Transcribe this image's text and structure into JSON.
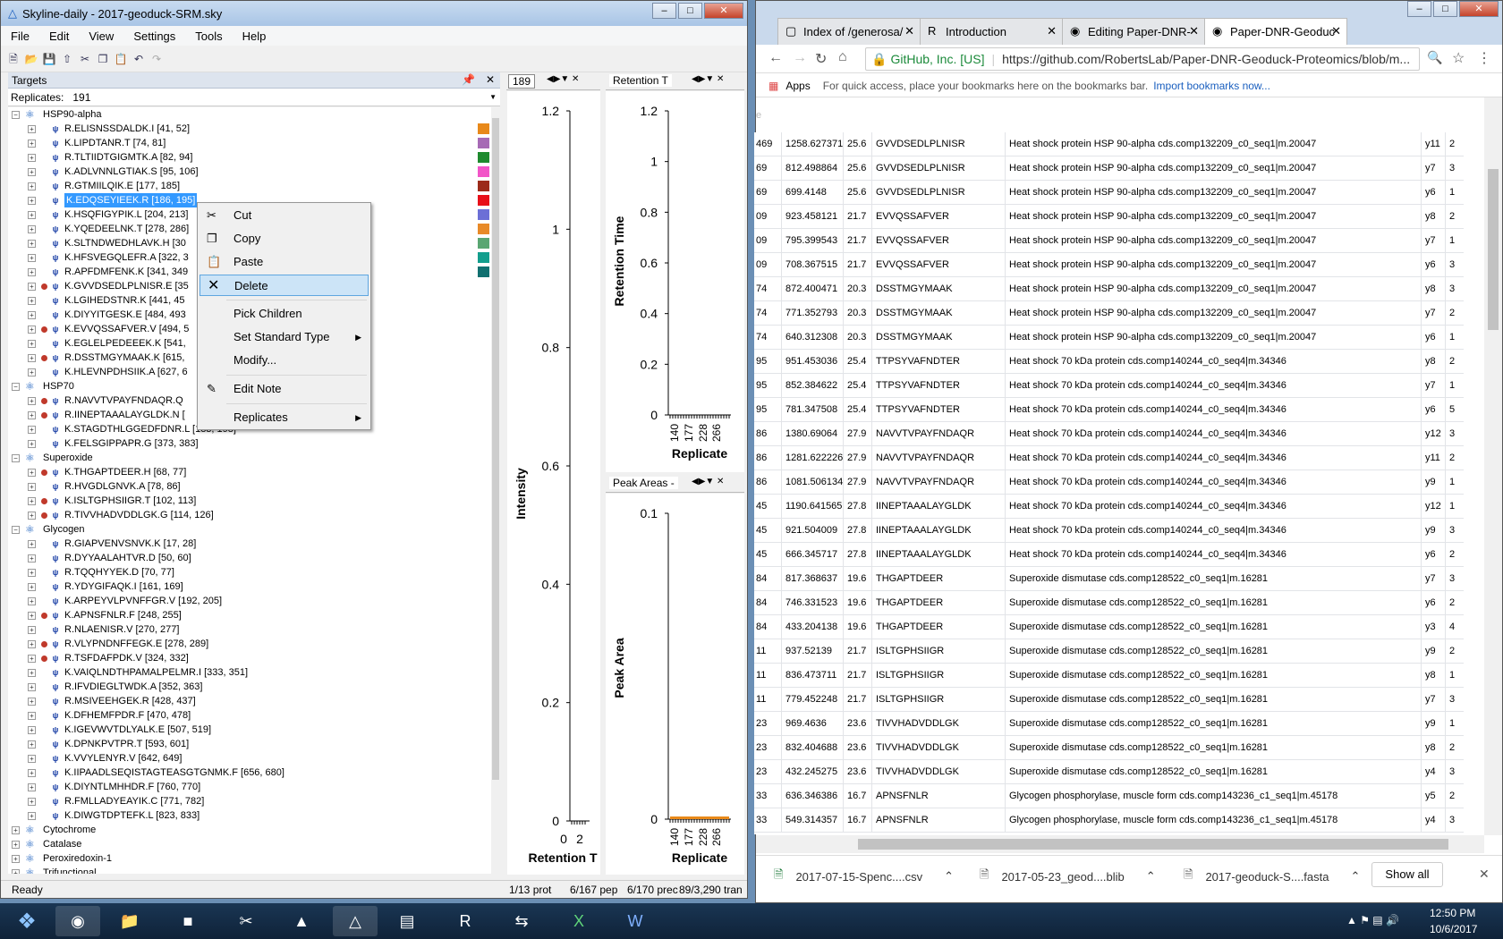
{
  "skyline": {
    "title": "Skyline-daily - 2017-geoduck-SRM.sky",
    "menus": [
      "File",
      "Edit",
      "View",
      "Settings",
      "Tools",
      "Help"
    ],
    "targets_title": "Targets",
    "replicates_label": "Replicates:",
    "replicates_value": "191",
    "tree": [
      {
        "kind": "protein",
        "label": "HSP90-alpha",
        "expanded": true
      },
      {
        "kind": "peptide",
        "label": "R.ELISNSSDALDK.I [41, 52]",
        "dot": false,
        "color": "#e8891a"
      },
      {
        "kind": "peptide",
        "label": "K.LIPDTANR.T [74, 81]",
        "dot": false,
        "color": "#a66ab5"
      },
      {
        "kind": "peptide",
        "label": "R.TLTIIDTGIGMTK.A [82, 94]",
        "dot": false,
        "color": "#1e8a2e"
      },
      {
        "kind": "peptide",
        "label": "K.ADLVNNLGTIAK.S [95, 106]",
        "dot": false,
        "color": "#f255c8"
      },
      {
        "kind": "peptide",
        "label": "R.GTMIILQIK.E [177, 185]",
        "dot": false,
        "color": "#9c2b1a"
      },
      {
        "kind": "peptide",
        "label": "K.EDQSEYIEEK.R [186, 195]",
        "dot": false,
        "color": "#e8101a",
        "selected": true
      },
      {
        "kind": "peptide",
        "label": "K.HSQFIGYPIK.L [204, 213]",
        "dot": false,
        "color": "#6c6fd6"
      },
      {
        "kind": "peptide",
        "label": "K.YQEDEELNK.T [278, 286]",
        "dot": false,
        "color": "#e88a28"
      },
      {
        "kind": "peptide",
        "label": "K.SLTNDWEDHLAVK.H [30",
        "dot": false,
        "color": "#5aa672"
      },
      {
        "kind": "peptide",
        "label": "K.HFSVEGQLEFR.A [322, 3",
        "dot": false,
        "color": "#139e8d"
      },
      {
        "kind": "peptide",
        "label": "R.APFDMFENK.K [341, 349",
        "dot": false,
        "color": "#117070"
      },
      {
        "kind": "peptide",
        "label": "K.GVVDSEDLPLNISR.E [35",
        "dot": true
      },
      {
        "kind": "peptide",
        "label": "K.LGIHEDSTNR.K [441, 45",
        "dot": false
      },
      {
        "kind": "peptide",
        "label": "K.DIYYITGESK.E [484, 493",
        "dot": false
      },
      {
        "kind": "peptide",
        "label": "K.EVVQSSAFVER.V [494, 5",
        "dot": true
      },
      {
        "kind": "peptide",
        "label": "K.EGLELPEDEEEK.K [541,",
        "dot": false
      },
      {
        "kind": "peptide",
        "label": "R.DSSTMGYMAAK.K [615,",
        "dot": true
      },
      {
        "kind": "peptide",
        "label": "K.HLEVNPDHSIIK.A [627, 6",
        "dot": false
      },
      {
        "kind": "protein",
        "label": "HSP70",
        "expanded": true
      },
      {
        "kind": "peptide",
        "label": "R.NAVVTVPAYFNDAQR.Q",
        "dot": true
      },
      {
        "kind": "peptide",
        "label": "R.IINEPTAAALAYGLDK.N [",
        "dot": true
      },
      {
        "kind": "peptide",
        "label": "K.STAGDTHLGGEDFDNR.L [183, 198]",
        "dot": false
      },
      {
        "kind": "peptide",
        "label": "K.FELSGIPPAPR.G [373, 383]",
        "dot": false
      },
      {
        "kind": "protein",
        "label": "Superoxide",
        "expanded": true
      },
      {
        "kind": "peptide",
        "label": "K.THGAPTDEER.H [68, 77]",
        "dot": true
      },
      {
        "kind": "peptide",
        "label": "R.HVGDLGNVK.A [78, 86]",
        "dot": false
      },
      {
        "kind": "peptide",
        "label": "K.ISLTGPHSIIGR.T [102, 113]",
        "dot": true
      },
      {
        "kind": "peptide",
        "label": "R.TIVVHADVDDLGK.G [114, 126]",
        "dot": true
      },
      {
        "kind": "protein",
        "label": "Glycogen",
        "expanded": true
      },
      {
        "kind": "peptide",
        "label": "R.GIAPVENVSNVK.K [17, 28]",
        "dot": false
      },
      {
        "kind": "peptide",
        "label": "R.DYYAALAHTVR.D [50, 60]",
        "dot": false
      },
      {
        "kind": "peptide",
        "label": "R.TQQHYYEK.D [70, 77]",
        "dot": false
      },
      {
        "kind": "peptide",
        "label": "R.YDYGIFAQK.I [161, 169]",
        "dot": false
      },
      {
        "kind": "peptide",
        "label": "K.ARPEYVLPVNFFGR.V [192, 205]",
        "dot": false
      },
      {
        "kind": "peptide",
        "label": "K.APNSFNLR.F [248, 255]",
        "dot": true
      },
      {
        "kind": "peptide",
        "label": "R.NLAENISR.V [270, 277]",
        "dot": false
      },
      {
        "kind": "peptide",
        "label": "R.VLYPNDNFFEGK.E [278, 289]",
        "dot": true
      },
      {
        "kind": "peptide",
        "label": "R.TSFDAFPDK.V [324, 332]",
        "dot": true
      },
      {
        "kind": "peptide",
        "label": "K.VAIQLNDTHPAMALPELMR.I [333, 351]",
        "dot": false
      },
      {
        "kind": "peptide",
        "label": "R.IFVDIEGLTWDK.A [352, 363]",
        "dot": false
      },
      {
        "kind": "peptide",
        "label": "R.MSIVEEHGEK.R [428, 437]",
        "dot": false
      },
      {
        "kind": "peptide",
        "label": "K.DFHEMFPDR.F [470, 478]",
        "dot": false
      },
      {
        "kind": "peptide",
        "label": "K.IGEVWVTDLYALK.E [507, 519]",
        "dot": false
      },
      {
        "kind": "peptide",
        "label": "K.DPNKPVTPR.T [593, 601]",
        "dot": false
      },
      {
        "kind": "peptide",
        "label": "K.VVYLENYR.V [642, 649]",
        "dot": false
      },
      {
        "kind": "peptide",
        "label": "K.IIPAADLSEQISTAGTEASGTGNMK.F [656, 680]",
        "dot": false
      },
      {
        "kind": "peptide",
        "label": "K.DIYNTLMHHDR.F [760, 770]",
        "dot": false
      },
      {
        "kind": "peptide",
        "label": "R.FMLLADYEAYIK.C [771, 782]",
        "dot": false
      },
      {
        "kind": "peptide",
        "label": "K.DIWGTDPTEFK.L [823, 833]",
        "dot": false
      },
      {
        "kind": "protein",
        "label": "Cytochrome",
        "expanded": false
      },
      {
        "kind": "protein",
        "label": "Catalase",
        "expanded": false
      },
      {
        "kind": "protein",
        "label": "Peroxiredoxin-1",
        "expanded": false
      },
      {
        "kind": "protein",
        "label": "Trifunctional",
        "expanded": false
      }
    ],
    "context_menu": {
      "cut": "Cut",
      "copy": "Copy",
      "paste": "Paste",
      "delete": "Delete",
      "pick_children": "Pick Children",
      "set_standard_type": "Set Standard Type",
      "modify": "Modify...",
      "edit_note": "Edit Note",
      "replicates": "Replicates"
    },
    "graph1": {
      "tab_label": "189",
      "y_label": "Intensity",
      "x_label": "Retention T",
      "y_ticks": [
        "1.2",
        "1",
        "0.8",
        "0.6",
        "0.4",
        "0.2",
        "0"
      ],
      "x_ticks": [
        "0",
        "2"
      ]
    },
    "graph2": {
      "tab_label": "Retention T",
      "y_label": "Retention Time",
      "x_label": "Replicate",
      "y_ticks": [
        "1.2",
        "1",
        "0.8",
        "0.6",
        "0.4",
        "0.2",
        "0"
      ],
      "x_ticks": [
        "140",
        "177",
        "228",
        "266"
      ]
    },
    "graph3": {
      "tab_label": "Peak Areas -",
      "y_label": "Peak Area",
      "x_label": "Replicate",
      "y_ticks": [
        "0.1",
        "0"
      ],
      "x_ticks": [
        "140",
        "177",
        "228",
        "266"
      ],
      "bar_color": "#e8891a"
    },
    "status": {
      "ready": "Ready",
      "prot": "1/13 prot",
      "pep": "6/167 pep",
      "prec": "6/170 prec",
      "tran": "89/3,290 tran"
    }
  },
  "chrome": {
    "tabs": [
      "Index of /generosa/",
      "Introduction",
      "Editing Paper-DNR-",
      "Paper-DNR-Geoduc"
    ],
    "secure_label": "GitHub, Inc. [US]",
    "url": "https://github.com/RobertsLab/Paper-DNR-Geoduck-Proteomics/blob/m...",
    "apps_label": "Apps",
    "bookmark_hint": "For quick access, place your bookmarks here on the bookmarks bar.",
    "bookmark_link": "Import bookmarks now...",
    "table_rows": [
      [
        "469",
        "1258.627371",
        "25.6",
        "GVVDSEDLPLNISR",
        "Heat shock protein HSP 90-alpha cds.comp132209_c0_seq1|m.20047",
        "y11",
        "2"
      ],
      [
        "69",
        "812.498864",
        "25.6",
        "GVVDSEDLPLNISR",
        "Heat shock protein HSP 90-alpha cds.comp132209_c0_seq1|m.20047",
        "y7",
        "3"
      ],
      [
        "69",
        "699.4148",
        "25.6",
        "GVVDSEDLPLNISR",
        "Heat shock protein HSP 90-alpha cds.comp132209_c0_seq1|m.20047",
        "y6",
        "1"
      ],
      [
        "09",
        "923.458121",
        "21.7",
        "EVVQSSAFVER",
        "Heat shock protein HSP 90-alpha cds.comp132209_c0_seq1|m.20047",
        "y8",
        "2"
      ],
      [
        "09",
        "795.399543",
        "21.7",
        "EVVQSSAFVER",
        "Heat shock protein HSP 90-alpha cds.comp132209_c0_seq1|m.20047",
        "y7",
        "1"
      ],
      [
        "09",
        "708.367515",
        "21.7",
        "EVVQSSAFVER",
        "Heat shock protein HSP 90-alpha cds.comp132209_c0_seq1|m.20047",
        "y6",
        "3"
      ],
      [
        "74",
        "872.400471",
        "20.3",
        "DSSTMGYMAAK",
        "Heat shock protein HSP 90-alpha cds.comp132209_c0_seq1|m.20047",
        "y8",
        "3"
      ],
      [
        "74",
        "771.352793",
        "20.3",
        "DSSTMGYMAAK",
        "Heat shock protein HSP 90-alpha cds.comp132209_c0_seq1|m.20047",
        "y7",
        "2"
      ],
      [
        "74",
        "640.312308",
        "20.3",
        "DSSTMGYMAAK",
        "Heat shock protein HSP 90-alpha cds.comp132209_c0_seq1|m.20047",
        "y6",
        "1"
      ],
      [
        "95",
        "951.453036",
        "25.4",
        "TTPSYVAFNDTER",
        "Heat shock 70 kDa protein cds.comp140244_c0_seq4|m.34346",
        "y8",
        "2"
      ],
      [
        "95",
        "852.384622",
        "25.4",
        "TTPSYVAFNDTER",
        "Heat shock 70 kDa protein cds.comp140244_c0_seq4|m.34346",
        "y7",
        "1"
      ],
      [
        "95",
        "781.347508",
        "25.4",
        "TTPSYVAFNDTER",
        "Heat shock 70 kDa protein cds.comp140244_c0_seq4|m.34346",
        "y6",
        "5"
      ],
      [
        "86",
        "1380.69064",
        "27.9",
        "NAVVTVPAYFNDAQR",
        "Heat shock 70 kDa protein cds.comp140244_c0_seq4|m.34346",
        "y12",
        "3"
      ],
      [
        "86",
        "1281.622226",
        "27.9",
        "NAVVTVPAYFNDAQR",
        "Heat shock 70 kDa protein cds.comp140244_c0_seq4|m.34346",
        "y11",
        "2"
      ],
      [
        "86",
        "1081.506134",
        "27.9",
        "NAVVTVPAYFNDAQR",
        "Heat shock 70 kDa protein cds.comp140244_c0_seq4|m.34346",
        "y9",
        "1"
      ],
      [
        "45",
        "1190.641565",
        "27.8",
        "IINEPTAAALAYGLDK",
        "Heat shock 70 kDa protein cds.comp140244_c0_seq4|m.34346",
        "y12",
        "1"
      ],
      [
        "45",
        "921.504009",
        "27.8",
        "IINEPTAAALAYGLDK",
        "Heat shock 70 kDa protein cds.comp140244_c0_seq4|m.34346",
        "y9",
        "3"
      ],
      [
        "45",
        "666.345717",
        "27.8",
        "IINEPTAAALAYGLDK",
        "Heat shock 70 kDa protein cds.comp140244_c0_seq4|m.34346",
        "y6",
        "2"
      ],
      [
        "84",
        "817.368637",
        "19.6",
        "THGAPTDEER",
        "Superoxide dismutase cds.comp128522_c0_seq1|m.16281",
        "y7",
        "3"
      ],
      [
        "84",
        "746.331523",
        "19.6",
        "THGAPTDEER",
        "Superoxide dismutase cds.comp128522_c0_seq1|m.16281",
        "y6",
        "2"
      ],
      [
        "84",
        "433.204138",
        "19.6",
        "THGAPTDEER",
        "Superoxide dismutase cds.comp128522_c0_seq1|m.16281",
        "y3",
        "4"
      ],
      [
        "11",
        "937.52139",
        "21.7",
        "ISLTGPHSIIGR",
        "Superoxide dismutase cds.comp128522_c0_seq1|m.16281",
        "y9",
        "2"
      ],
      [
        "11",
        "836.473711",
        "21.7",
        "ISLTGPHSIIGR",
        "Superoxide dismutase cds.comp128522_c0_seq1|m.16281",
        "y8",
        "1"
      ],
      [
        "11",
        "779.452248",
        "21.7",
        "ISLTGPHSIIGR",
        "Superoxide dismutase cds.comp128522_c0_seq1|m.16281",
        "y7",
        "3"
      ],
      [
        "23",
        "969.4636",
        "23.6",
        "TIVVHADVDDLGK",
        "Superoxide dismutase cds.comp128522_c0_seq1|m.16281",
        "y9",
        "1"
      ],
      [
        "23",
        "832.404688",
        "23.6",
        "TIVVHADVDDLGK",
        "Superoxide dismutase cds.comp128522_c0_seq1|m.16281",
        "y8",
        "2"
      ],
      [
        "23",
        "432.245275",
        "23.6",
        "TIVVHADVDDLGK",
        "Superoxide dismutase cds.comp128522_c0_seq1|m.16281",
        "y4",
        "3"
      ],
      [
        "33",
        "636.346386",
        "16.7",
        "APNSFNLR",
        "Glycogen phosphorylase, muscle form cds.comp143236_c1_seq1|m.45178",
        "y5",
        "2"
      ],
      [
        "33",
        "549.314357",
        "16.7",
        "APNSFNLR",
        "Glycogen phosphorylase, muscle form cds.comp143236_c1_seq1|m.45178",
        "y4",
        "3"
      ]
    ],
    "downloads": [
      "2017-07-15-Spenc....csv",
      "2017-05-23_geod....blib",
      "2017-geoduck-S....fasta"
    ],
    "show_all": "Show all"
  },
  "taskbar": {
    "time": "12:50 PM",
    "date": "10/6/2017"
  }
}
